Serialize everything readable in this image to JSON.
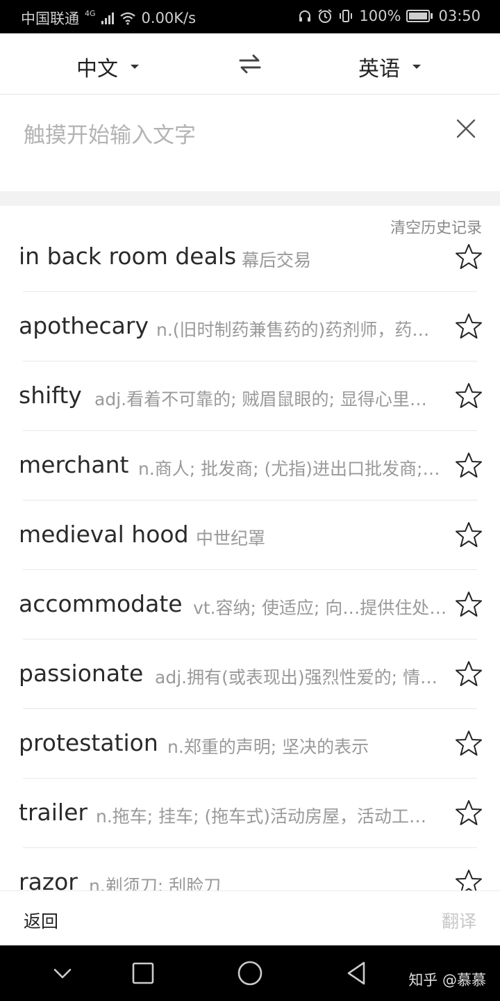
{
  "status_bar": {
    "carrier": "中国联通",
    "network": "4G",
    "speed": "0.00K/s",
    "battery": "100%",
    "time": "03:50"
  },
  "language_bar": {
    "source_language": "中文",
    "target_language": "英语",
    "swap_icon": "swap-arrows-icon"
  },
  "input": {
    "placeholder": "触摸开始输入文字",
    "value": ""
  },
  "history": {
    "clear_label": "清空历史记录",
    "items": [
      {
        "word": "in back room deals",
        "definition": "幕后交易"
      },
      {
        "word": "apothecary",
        "definition": "n.(旧时制药兼售药的)药剂师，药…"
      },
      {
        "word": "shifty",
        "definition": "adj.看着不可靠的; 贼眉鼠眼的; 显得心里…"
      },
      {
        "word": "merchant",
        "definition": "n.商人; 批发商; (尤指)进出口批发商;…"
      },
      {
        "word": "medieval hood",
        "definition": "中世纪罩"
      },
      {
        "word": "accommodate",
        "definition": "vt.容纳; 使适应; 向…提供住处;…"
      },
      {
        "word": "passionate",
        "definition": "adj.拥有(或表现出)强烈性爱的; 情…"
      },
      {
        "word": "protestation",
        "definition": "n.郑重的声明; 坚决的表示"
      },
      {
        "word": "trailer",
        "definition": "n.拖车; 挂车; (拖车式)活动房屋，活动工…"
      },
      {
        "word": "razor",
        "definition": "n.剃须刀; 刮脸刀"
      }
    ]
  },
  "action_bar": {
    "back_label": "返回",
    "translate_label": "翻译"
  },
  "watermark": "知乎 @慕慕"
}
